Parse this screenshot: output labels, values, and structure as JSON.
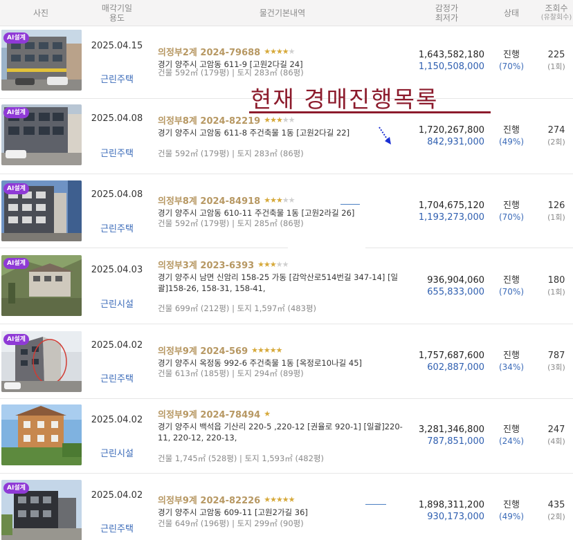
{
  "header": {
    "photo": "사진",
    "date_use_line1": "매각기일",
    "date_use_line2": "용도",
    "basic_info": "물건기본내역",
    "price_line1": "감정가",
    "price_line2": "최저가",
    "status": "상태",
    "views_line1": "조회수",
    "views_line2": "(유찰회수)"
  },
  "overlay": {
    "text": "현재  경매진행목록",
    "color": "#8c1b2c"
  },
  "badge_label": "AI설계",
  "rows": [
    {
      "badge": true,
      "date": "2025.04.15",
      "use": "근린주택",
      "case_no": "의정부2계 2024-79688",
      "stars_on": "★★★★",
      "stars_off": "★",
      "address": "경기 양주시 고암동 611-9 [고원2다길 24]",
      "area": "건물 592㎡ (179평)  |  토지 283㎡ (86평)",
      "appraised": "1,643,582,180",
      "minimum": "1,150,508,000",
      "status": "진행",
      "pct": "(70%)",
      "views": "225",
      "fails": "(1회)"
    },
    {
      "badge": true,
      "date": "2025.04.08",
      "use": "근린주택",
      "case_no": "의정부8계 2024-82219",
      "stars_on": "★★★",
      "stars_off": "★★",
      "address": "경기 양주시 고암동 611-8 주건축물 1동 [고원2다길 22]",
      "area": "건물 592㎡ (179평)  |  토지 283㎡ (86평)",
      "appraised": "1,720,267,800",
      "minimum": "842,931,000",
      "status": "진행",
      "pct": "(49%)",
      "views": "274",
      "fails": "(2회)"
    },
    {
      "badge": true,
      "date": "2025.04.08",
      "use": "근린주택",
      "case_no": "의정부8계 2024-84918",
      "stars_on": "★★★",
      "stars_off": "★★",
      "address": "경기 양주시 고암동 610-11 주건축물 1동 [고원2라길 26]",
      "area": "건물 592㎡ (179평)  |  토지 285㎡ (86평)",
      "appraised": "1,704,675,120",
      "minimum": "1,193,273,000",
      "status": "진행",
      "pct": "(70%)",
      "views": "126",
      "fails": "(1회)"
    },
    {
      "badge": true,
      "date": "2025.04.03",
      "use": "근린시설",
      "case_no": "의정부3계 2023-6393",
      "stars_on": "★★★",
      "stars_off": "★★",
      "address": "경기 양주시 남면 신암리 158-25 가동 [감악산로514번길 347-14] [일괄]158-26, 158-31, 158-41,",
      "area": "건물 699㎡ (212평)  |  토지 1,597㎡ (483평)",
      "appraised": "936,904,060",
      "minimum": "655,833,000",
      "status": "진행",
      "pct": "(70%)",
      "views": "180",
      "fails": "(1회)"
    },
    {
      "badge": true,
      "date": "2025.04.02",
      "use": "근린주택",
      "case_no": "의정부9계 2024-569",
      "stars_on": "★★★★★",
      "stars_off": "",
      "address": "경기 양주시 옥정동 992-6 주건축물 1동 [옥정로10나길 45]",
      "area": "건물 613㎡ (185평)  |  토지 294㎡ (89평)",
      "appraised": "1,757,687,600",
      "minimum": "602,887,000",
      "status": "진행",
      "pct": "(34%)",
      "views": "787",
      "fails": "(3회)"
    },
    {
      "badge": false,
      "date": "2025.04.02",
      "use": "근린시설",
      "case_no": "의정부9계 2024-78494",
      "stars_on": "★",
      "stars_off": "",
      "address": "경기 양주시 백석읍 기산리 220-5 ,220-12 [권율로 920-1] [일괄]220-11, 220-12, 220-13,",
      "area": "건물 1,745㎡ (528평)  |  토지 1,593㎡ (482평)",
      "appraised": "3,281,346,800",
      "minimum": "787,851,000",
      "status": "진행",
      "pct": "(24%)",
      "views": "247",
      "fails": "(4회)"
    },
    {
      "badge": true,
      "date": "2025.04.02",
      "use": "근린주택",
      "case_no": "의정부9계 2024-82226",
      "stars_on": "★★★★★",
      "stars_off": "",
      "address": "경기 양주시 고암동 609-11 [고원2가길 36]",
      "area": "건물 649㎡ (196평)  |  토지 299㎡ (90평)",
      "appraised": "1,898,311,200",
      "minimum": "930,173,000",
      "status": "진행",
      "pct": "(49%)",
      "views": "435",
      "fails": "(2회)"
    }
  ]
}
